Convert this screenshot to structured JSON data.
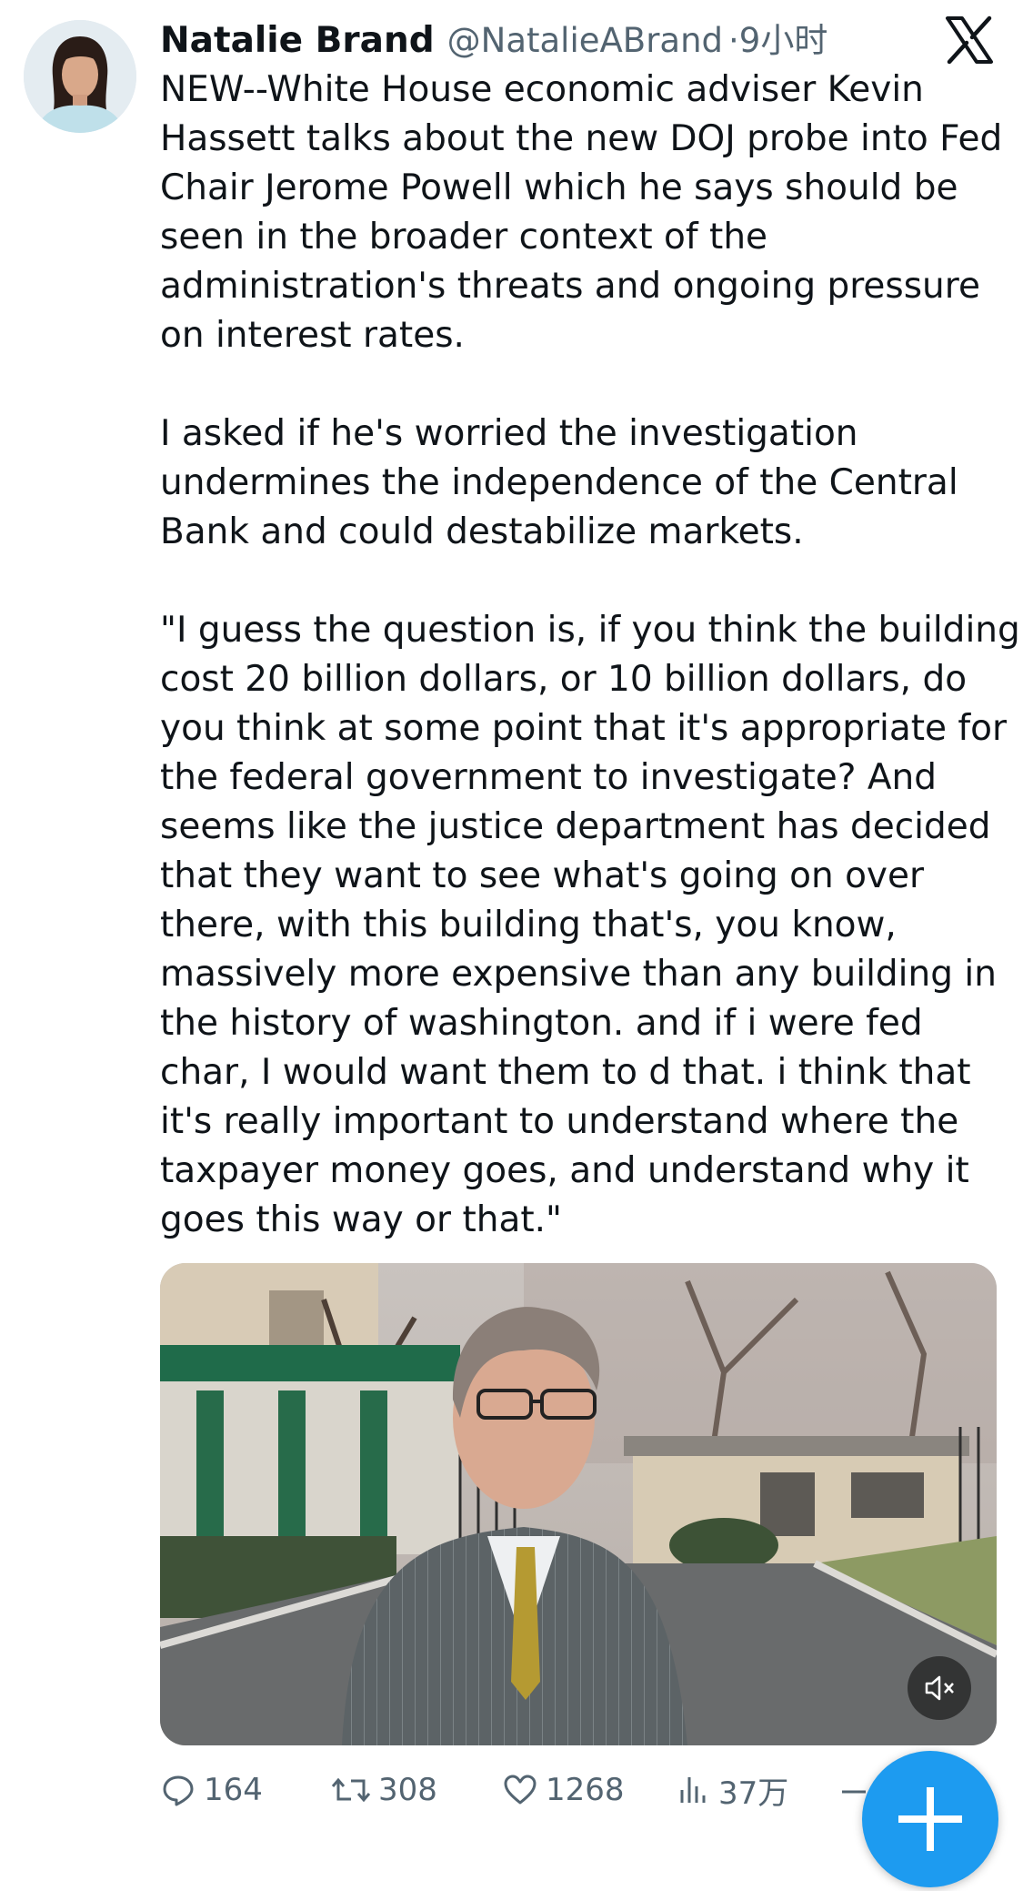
{
  "author": {
    "name": "Natalie Brand",
    "handle": "@NatalieABrand",
    "time": "·9小时"
  },
  "tweet": {
    "paragraphs": [
      "NEW--White House economic adviser Kevin\nHassett talks about the new DOJ probe into Fed\nChair Jerome Powell which he says should be\nseen in the broader context of the\nadministration's threats and ongoing pressure\non interest rates.",
      "I asked if he's worried the investigation\nundermines the independence of the Central\nBank and could destabilize markets.",
      "\"I guess the question is, if you think the building\ncost 20 billion dollars, or 10 billion dollars, do\nyou think at some point that it's appropriate for\nthe federal government to investigate? And\nseems like the justice department has decided\nthat they want to see what's going on over\nthere, with this building that's, you know,\nmassively more expensive than any building in\nthe history of washington. and if i were fed\nchar, I would want them to d that. i think that\nit's really important to understand where the\ntaxpayer money goes, and understand why it\ngoes this way or that.\""
    ]
  },
  "actions": {
    "replies": "164",
    "retweets": "308",
    "likes": "1268",
    "views": "37万"
  },
  "icons": {
    "platform": "x-logo-icon",
    "reply": "reply-icon",
    "retweet": "retweet-icon",
    "like": "heart-icon",
    "views": "views-icon",
    "mute": "mute-icon",
    "compose": "compose-fab-icon"
  },
  "colors": {
    "text": "#0f1419",
    "secondary": "#536471",
    "accent": "#1d9bf0"
  }
}
